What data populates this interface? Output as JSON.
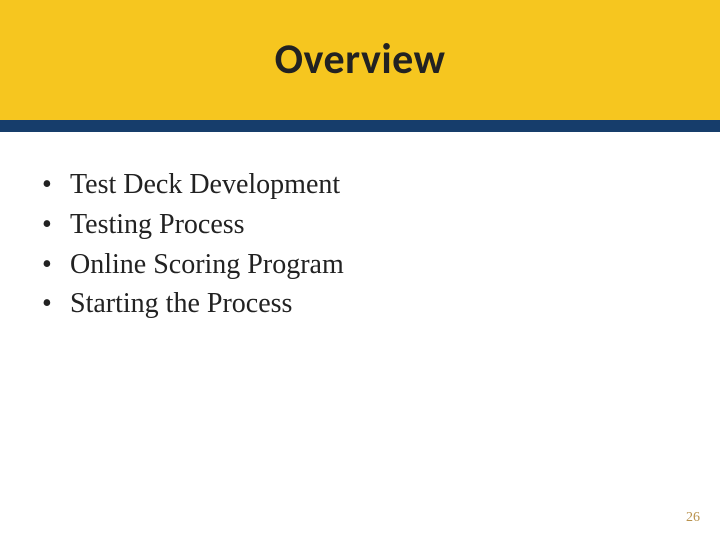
{
  "title": "Overview",
  "bullets": [
    "Test Deck Development",
    "Testing Process",
    "Online Scoring Program",
    "Starting the Process"
  ],
  "page_number": "26",
  "colors": {
    "band": "#f6c61f",
    "accent": "#163d6b"
  }
}
